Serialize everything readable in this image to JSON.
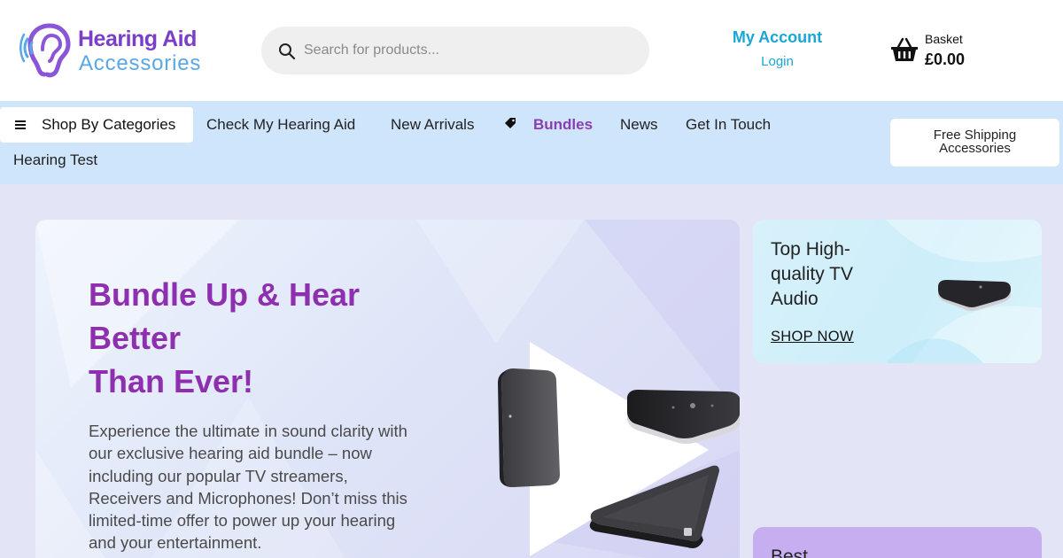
{
  "brand": {
    "name_line1": "Hearing Aid",
    "name_line2": "Accessories",
    "colors": {
      "purple": "#7a3ec8",
      "blue": "#5aa7e6"
    }
  },
  "search": {
    "placeholder": "Search for products..."
  },
  "account": {
    "title": "My Account",
    "login": "Login"
  },
  "basket": {
    "label": "Basket",
    "total": "£0.00"
  },
  "nav": {
    "categories_label": "Shop By Categories",
    "links": [
      "Check My Hearing Aid",
      "New Arrivals",
      "Bundles",
      "News",
      "Get In Touch",
      "Hearing Test"
    ],
    "shipping_line1": "Free Shipping",
    "shipping_line2": "Accessories",
    "active_color": "#8b3db3",
    "bar_color": "#cfe5fb"
  },
  "hero": {
    "title_lines": [
      "Bundle Up & Hear",
      "Better",
      "Than Ever!"
    ],
    "description": "Experience the ultimate in sound clarity with our exclusive hearing aid bundle – now including our popular TV streamers, Receivers and Microphones! Don’t miss this limited-time offer to power up your hearing and your entertainment.",
    "title_color": "#8e2fb0"
  },
  "promo_tv": {
    "title": "Top High-quality TV Audio",
    "link": "SHOP NOW"
  },
  "promo_best": {
    "title": "Best"
  }
}
